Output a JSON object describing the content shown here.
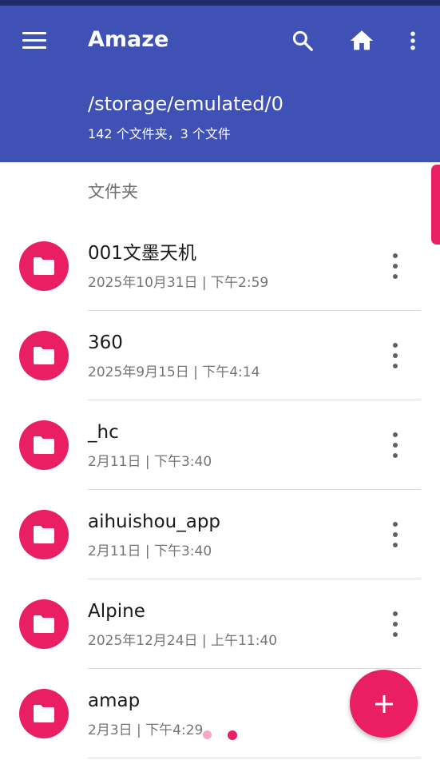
{
  "toolbar": {
    "title": "Amaze",
    "menu_icon": "hamburger-menu-icon",
    "search_icon": "search-icon",
    "home_icon": "home-icon",
    "more_icon": "more-vert-icon"
  },
  "location": {
    "path": "/storage/emulated/0",
    "summary": "142 个文件夹，3 个文件"
  },
  "section_header": "文件夹",
  "files": [
    {
      "name": "001文墨天机",
      "meta": "2025年10月31日 | 下午2:59",
      "icon": "folder-icon"
    },
    {
      "name": "360",
      "meta": "2025年9月15日 | 下午4:14",
      "icon": "folder-icon"
    },
    {
      "name": "_hc",
      "meta": "2月11日 | 下午3:40",
      "icon": "folder-icon"
    },
    {
      "name": "aihuishou_app",
      "meta": "2月11日 | 下午3:40",
      "icon": "folder-icon"
    },
    {
      "name": "Alpine",
      "meta": "2025年12月24日 | 上午11:40",
      "icon": "folder-icon"
    },
    {
      "name": "amap",
      "meta": "2月3日 | 下午4:29",
      "icon": "folder-icon"
    }
  ],
  "fab": {
    "icon": "plus-icon"
  },
  "colors": {
    "primary": "#3f51b5",
    "status_bar": "#1f2a6b",
    "accent": "#e91e63"
  }
}
